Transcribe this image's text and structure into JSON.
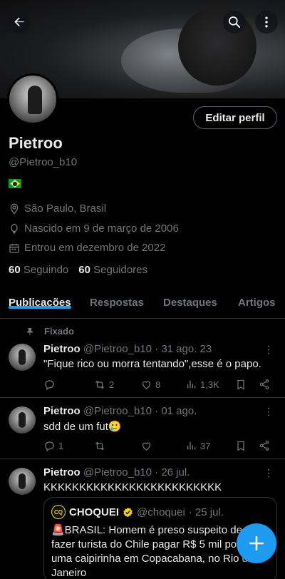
{
  "profile": {
    "name": "Pietroo",
    "handle": "@Pietroo_b10",
    "edit_label": "Editar perfil",
    "location": "São Paulo, Brasil",
    "birth": "Nascido em 9 de março de 2006",
    "joined": "Entrou em dezembro de 2022",
    "following_count": "60",
    "following_label": "Seguindo",
    "followers_count": "60",
    "followers_label": "Seguidores"
  },
  "tabs": [
    "Publicações",
    "Respostas",
    "Destaques",
    "Artigos"
  ],
  "pinned_label": "Fixado",
  "posts": [
    {
      "name": "Pietroo",
      "handle": "@Pietroo_b10",
      "date": "· 31 ago. 23",
      "text": "\"Fique rico ou morra tentando\",esse é o papo.",
      "replies": "",
      "reposts": "2",
      "likes": "8",
      "views": "1,3K"
    },
    {
      "name": "Pietroo",
      "handle": "@Pietroo_b10",
      "date": "· 01 ago.",
      "text": "sdd de um fut🥲",
      "replies": "1",
      "reposts": "",
      "likes": "",
      "views": "37"
    },
    {
      "name": "Pietroo",
      "handle": "@Pietroo_b10",
      "date": "· 26 jul.",
      "text": "KKKKKKKKKKKKKKKKKKKKKKKKK"
    }
  ],
  "quote": {
    "name": "CHOQUEI",
    "handle": "@choquei",
    "date": "· 25 jul.",
    "line1": "🚨BRASIL: Homem é preso suspeito de",
    "line2": "fazer turista do Chile pagar R$ 5 mil por",
    "line3": "uma caipirinha em Copacabana, no Rio de",
    "line4": "Janeiro"
  },
  "colors": {
    "accent": "#1d9bf0",
    "muted": "#71767b",
    "text": "#e7e9ea",
    "border": "#2f3336"
  }
}
